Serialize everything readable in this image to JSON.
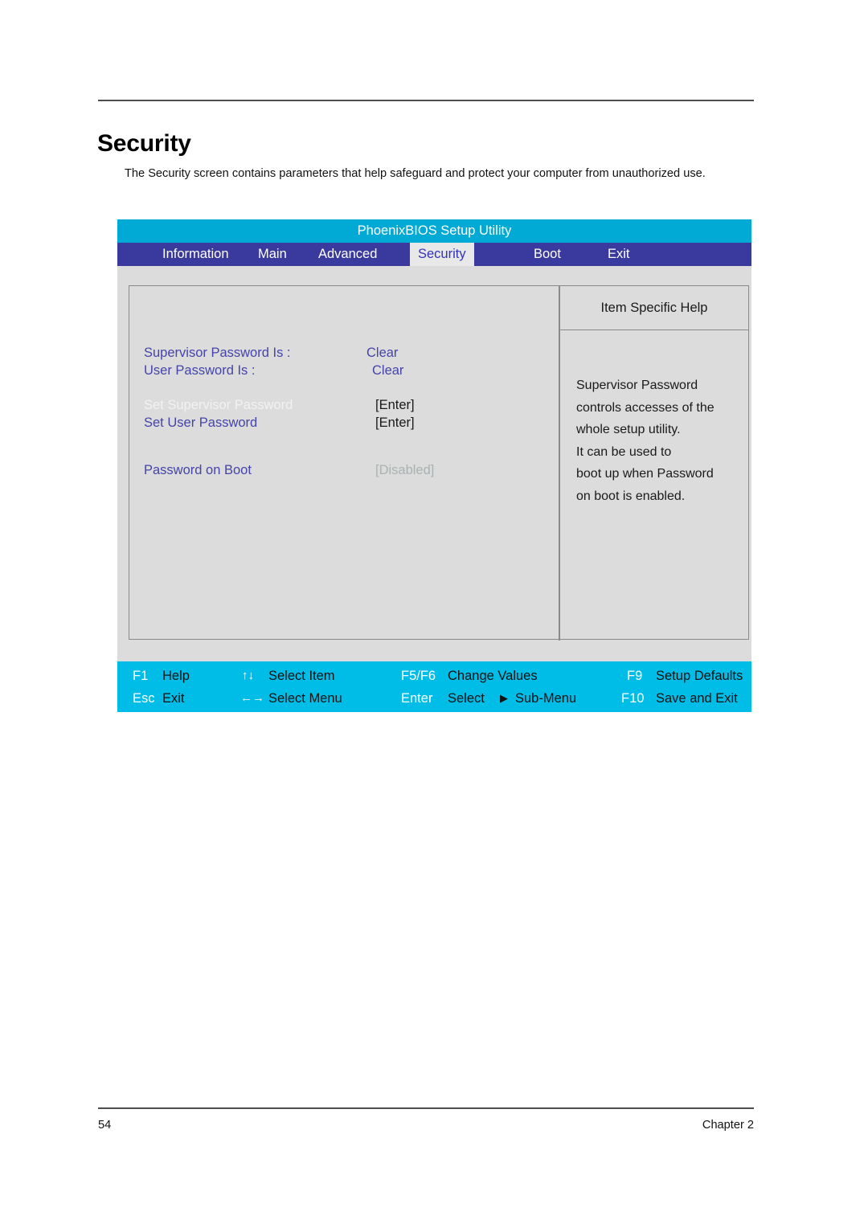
{
  "page": {
    "title": "Security",
    "intro": "The Security screen contains parameters that help safeguard and protect your computer from unauthorized use.",
    "page_number": "54",
    "chapter": "Chapter 2"
  },
  "bios": {
    "utility_title": "PhoenixBIOS Setup Utility",
    "tabs": [
      {
        "label": "Information",
        "active": false
      },
      {
        "label": "Main",
        "active": false
      },
      {
        "label": "Advanced",
        "active": false
      },
      {
        "label": "Security",
        "active": true
      },
      {
        "label": "Boot",
        "active": false
      },
      {
        "label": "Exit",
        "active": false
      }
    ],
    "settings": [
      {
        "label": "Supervisor Password Is :",
        "value": "Clear",
        "label_style": "blue",
        "value_style": "blue"
      },
      {
        "label": "User Password Is :",
        "value": "Clear",
        "label_style": "blue",
        "value_style": "blue"
      },
      {
        "label": "Set Supervisor Password",
        "value": "[Enter]",
        "label_style": "white",
        "value_style": "dark"
      },
      {
        "label": "Set User Password",
        "value": "[Enter]",
        "label_style": "blue",
        "value_style": "dark"
      },
      {
        "label": "Password on Boot",
        "value": "[Disabled]",
        "label_style": "blue",
        "value_style": "gray"
      }
    ],
    "help": {
      "title": "Item Specific Help",
      "lines": [
        "Supervisor Password",
        "controls accesses of the",
        "whole setup utility.",
        "It can be used to",
        "boot up when Password",
        "on boot is enabled."
      ]
    },
    "keybar": [
      {
        "key": "F1",
        "desc": "Help",
        "arrows": ""
      },
      {
        "key": "",
        "desc": "Select Item",
        "arrows": "↑↓"
      },
      {
        "key": "F5/F6",
        "desc": "Change Values",
        "arrows": ""
      },
      {
        "key": "F9",
        "desc": "Setup Defaults",
        "arrows": ""
      },
      {
        "key": "Esc",
        "desc": "Exit",
        "arrows": ""
      },
      {
        "key": "",
        "desc": "Select Menu",
        "arrows": "←→"
      },
      {
        "key": "Enter",
        "desc": "Select",
        "arrows": ""
      },
      {
        "key": "",
        "desc": "Sub-Menu",
        "arrows": "▶"
      },
      {
        "key": "F10",
        "desc": "Save and Exit",
        "arrows": ""
      }
    ],
    "colors": {
      "title_bar": "#00aad4",
      "tab_bar": "#3a3a9e",
      "screen_bg": "#dcdcdc",
      "key_bar": "#00bde8",
      "label_blue": "#4444aa",
      "active_tab_bg": "#e8e8e8"
    }
  }
}
